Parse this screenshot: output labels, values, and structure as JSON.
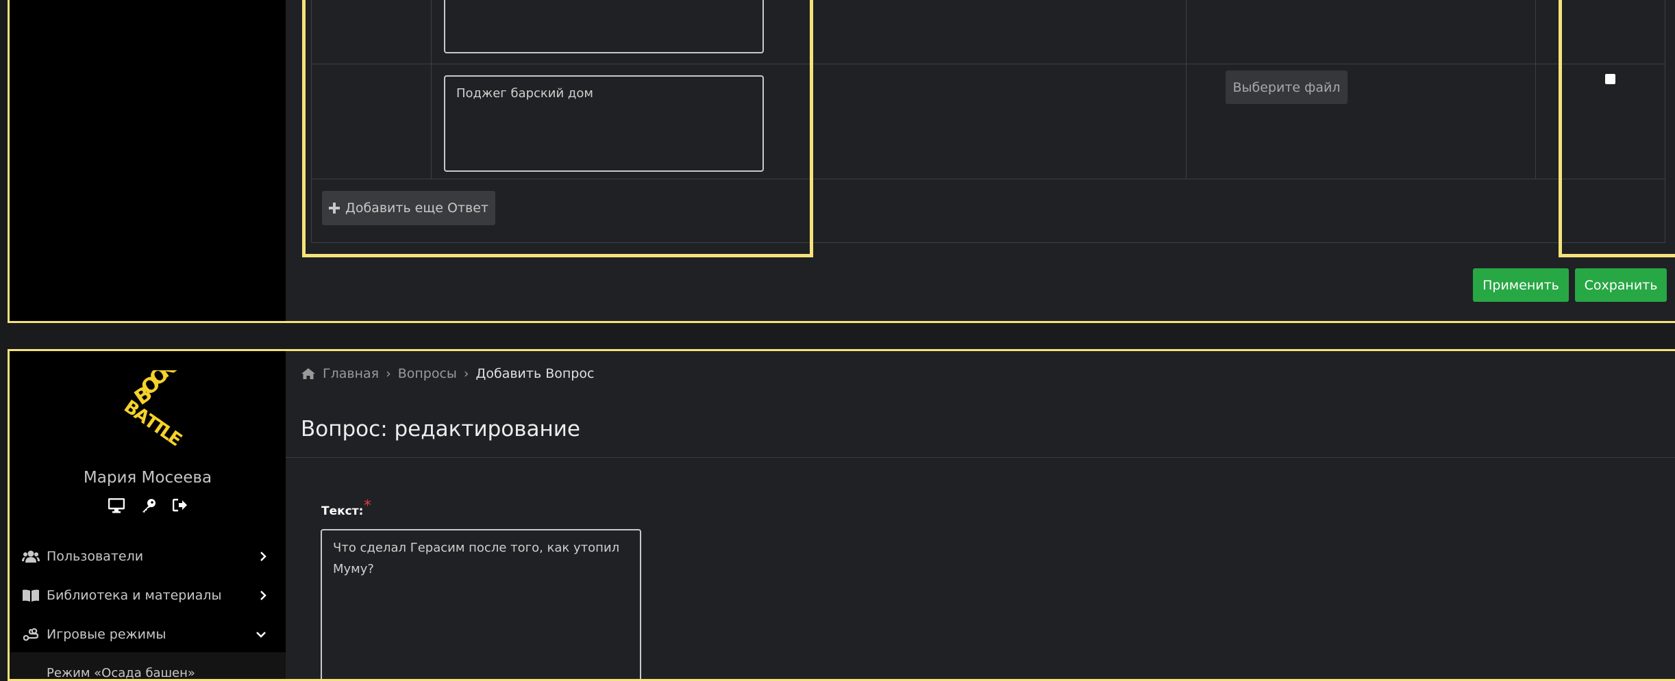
{
  "top_panel": {
    "answer_text": "Поджег барский дом",
    "file_button_label": "Выберите файл",
    "add_answer_label": "Добавить еще Ответ",
    "apply_label": "Применить",
    "save_label": "Сохранить"
  },
  "sidebar": {
    "logo_text": "BOOK BATTLE",
    "user_name": "Мария Мосеева",
    "nav_items": [
      {
        "label": "Пользователи",
        "icon": "users-icon",
        "expanded": false
      },
      {
        "label": "Библиотека и материалы",
        "icon": "book-icon",
        "expanded": false
      },
      {
        "label": "Игровые режимы",
        "icon": "game-modes-icon",
        "expanded": true
      }
    ],
    "sub_items": [
      {
        "label": "Режим «Осада башен»"
      }
    ]
  },
  "breadcrumb": {
    "home": "Главная",
    "questions": "Вопросы",
    "current": "Добавить Вопрос"
  },
  "page_title": "Вопрос: редактирование",
  "form": {
    "text_label": "Текст:",
    "required_mark": "*",
    "question_text": "Что сделал Герасим после того, как утопил Муму?"
  },
  "colors": {
    "highlight": "#f6e27a",
    "success": "#28a745",
    "background": "#202124",
    "sidebar": "#000000"
  }
}
